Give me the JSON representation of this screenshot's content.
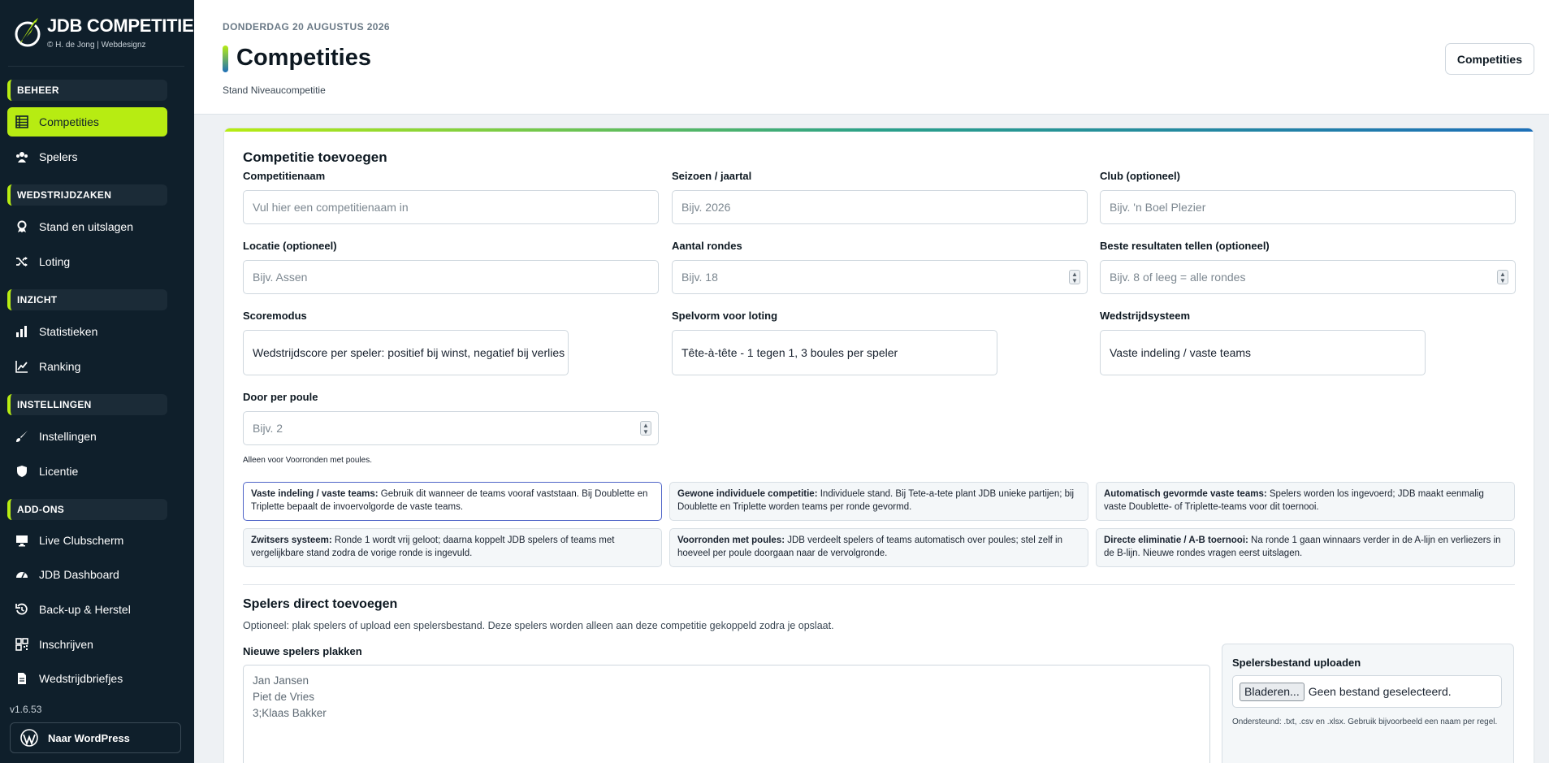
{
  "brand": {
    "title": "JDB COMPETITIE",
    "subtitle": "© H. de Jong | Webdesignz"
  },
  "sidebar": {
    "sections": [
      "BEHEER",
      "WEDSTRIJDZAKEN",
      "INZICHT",
      "INSTELLINGEN",
      "ADD-ONS"
    ],
    "items": [
      {
        "label": "Competities",
        "icon": "table-icon",
        "active": true
      },
      {
        "label": "Spelers",
        "icon": "users-icon"
      },
      {
        "label": "Stand en uitslagen",
        "icon": "award-icon"
      },
      {
        "label": "Loting",
        "icon": "shuffle-icon"
      },
      {
        "label": "Statistieken",
        "icon": "bar-chart-icon"
      },
      {
        "label": "Ranking",
        "icon": "trend-icon"
      },
      {
        "label": "Instellingen",
        "icon": "brush-icon"
      },
      {
        "label": "Licentie",
        "icon": "shield-icon"
      },
      {
        "label": "Live Clubscherm",
        "icon": "monitor-icon"
      },
      {
        "label": "JDB Dashboard",
        "icon": "gauge-icon"
      },
      {
        "label": "Back-up & Herstel",
        "icon": "history-icon"
      },
      {
        "label": "Inschrijven",
        "icon": "qr-icon"
      },
      {
        "label": "Wedstrijdbriefjes",
        "icon": "document-icon"
      }
    ],
    "version": "v1.6.53",
    "wordpress": "Naar WordPress"
  },
  "header": {
    "date": "DONDERDAG 20 AUGUSTUS 2026",
    "title": "Competities",
    "subtitle": "Stand Niveaucompetitie",
    "button": "Competities"
  },
  "form": {
    "heading": "Competitie toevoegen",
    "name": {
      "label": "Competitienaam",
      "placeholder": "Vul hier een competitienaam in"
    },
    "season": {
      "label": "Seizoen / jaartal",
      "placeholder": "Bijv. 2026"
    },
    "club": {
      "label": "Club (optioneel)",
      "placeholder": "Bijv. 'n Boel Plezier"
    },
    "location": {
      "label": "Locatie (optioneel)",
      "placeholder": "Bijv. Assen"
    },
    "rounds": {
      "label": "Aantal rondes",
      "placeholder": "Bijv. 18"
    },
    "best": {
      "label": "Beste resultaten tellen (optioneel)",
      "placeholder": "Bijv. 8 of leeg = alle rondes"
    },
    "scoremode": {
      "label": "Scoremodus",
      "value": "Wedstrijdscore per speler: positief bij winst, negatief bij verlies"
    },
    "gameform": {
      "label": "Spelvorm voor loting",
      "value": "Tête-à-tête - 1 tegen 1, 3 boules per speler"
    },
    "system": {
      "label": "Wedstrijdsysteem",
      "value": "Vaste indeling / vaste teams"
    },
    "perpool": {
      "label": "Door per poule",
      "placeholder": "Bijv. 2",
      "hint": "Alleen voor Voorronden met poules."
    }
  },
  "options": [
    {
      "title": "Vaste indeling / vaste teams:",
      "text": " Gebruik dit wanneer de teams vooraf vaststaan. Bij Doublette en Triplette bepaalt de invoervolgorde de vaste teams."
    },
    {
      "title": "Gewone individuele competitie:",
      "text": " Individuele stand. Bij Tete-a-tete plant JDB unieke partijen; bij Doublette en Triplette worden teams per ronde gevormd."
    },
    {
      "title": "Automatisch gevormde vaste teams:",
      "text": " Spelers worden los ingevoerd; JDB maakt eenmalig vaste Doublette- of Triplette-teams voor dit toernooi."
    },
    {
      "title": "Zwitsers systeem:",
      "text": " Ronde 1 wordt vrij geloot; daarna koppelt JDB spelers of teams met vergelijkbare stand zodra de vorige ronde is ingevuld."
    },
    {
      "title": "Voorronden met poules:",
      "text": " JDB verdeelt spelers of teams automatisch over poules; stel zelf in hoeveel per poule doorgaan naar de vervolgronde."
    },
    {
      "title": "Directe eliminatie / A-B toernooi:",
      "text": " Na ronde 1 gaan winnaars verder in de A-lijn en verliezers in de B-lijn. Nieuwe rondes vragen eerst uitslagen."
    }
  ],
  "players": {
    "heading": "Spelers direct toevoegen",
    "subtitle": "Optioneel: plak spelers of upload een spelersbestand. Deze spelers worden alleen aan deze competitie gekoppeld zodra je opslaat.",
    "paste_label": "Nieuwe spelers plakken",
    "paste_placeholder": "Jan Jansen\nPiet de Vries\n3;Klaas Bakker",
    "upload_title": "Spelersbestand uploaden",
    "browse": "Bladeren...",
    "no_file": "Geen bestand geselecteerd.",
    "upload_hint": "Ondersteund: .txt, .csv en .xlsx. Gebruik bijvoorbeeld een naam per regel."
  }
}
